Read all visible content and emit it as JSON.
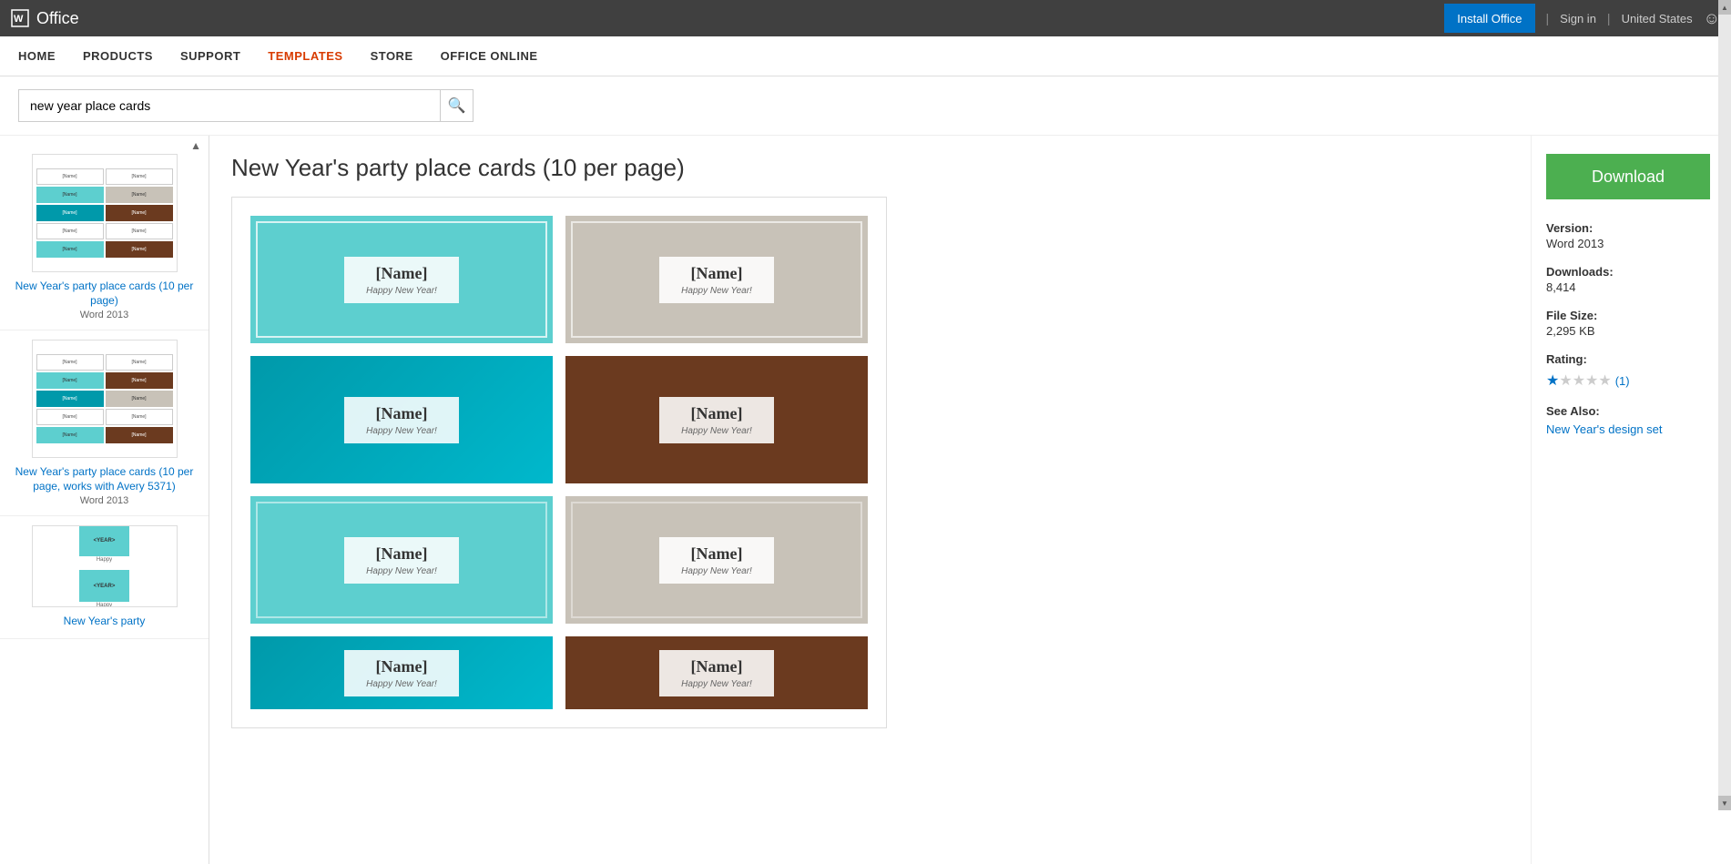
{
  "topbar": {
    "office_title": "Office",
    "install_btn": "Install Office",
    "sign_in": "Sign in",
    "divider": "|",
    "region": "United States",
    "smiley": "☺"
  },
  "nav": {
    "items": [
      {
        "label": "HOME",
        "active": false
      },
      {
        "label": "PRODUCTS",
        "active": false
      },
      {
        "label": "SUPPORT",
        "active": false
      },
      {
        "label": "TEMPLATES",
        "active": true
      },
      {
        "label": "STORE",
        "active": false
      },
      {
        "label": "OFFICE ONLINE",
        "active": false
      }
    ]
  },
  "search": {
    "value": "new year place cards",
    "placeholder": "Search templates",
    "search_icon": "🔍"
  },
  "page": {
    "title": "New Year's party place cards (10 per page)"
  },
  "sidebar": {
    "items": [
      {
        "title": "New Year's party place cards (10 per page)",
        "version": "Word 2013"
      },
      {
        "title": "New Year's party place cards (10 per page, works with Avery 5371)",
        "version": "Word 2013"
      },
      {
        "title": "New Year's party"
      }
    ]
  },
  "template": {
    "cards": [
      {
        "name": "[Name]",
        "subtitle": "Happy New Year!",
        "style": "teal"
      },
      {
        "name": "[Name]",
        "subtitle": "Happy New Year!",
        "style": "gray"
      },
      {
        "name": "[Name]",
        "subtitle": "Happy New Year!",
        "style": "teal2"
      },
      {
        "name": "[Name]",
        "subtitle": "Happy New Year!",
        "style": "brown"
      },
      {
        "name": "[Name]",
        "subtitle": "Happy New Year!",
        "style": "teal"
      },
      {
        "name": "[Name]",
        "subtitle": "Happy New Year!",
        "style": "gray"
      },
      {
        "name": "[Name]",
        "subtitle": "Happy New Year!",
        "style": "teal2"
      },
      {
        "name": "[Name]",
        "subtitle": "Happy New Year!",
        "style": "brown"
      }
    ]
  },
  "right_panel": {
    "download_btn": "Download",
    "version_label": "Version:",
    "version_value": "Word 2013",
    "downloads_label": "Downloads:",
    "downloads_value": "8,414",
    "filesize_label": "File Size:",
    "filesize_value": "2,295 KB",
    "rating_label": "Rating:",
    "rating_count": "(1)",
    "see_also_label": "See Also:",
    "see_also_link": "New Year's design set"
  }
}
